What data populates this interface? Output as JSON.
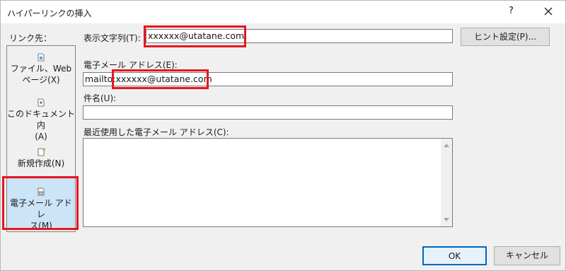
{
  "window": {
    "title": "ハイパーリンクの挿入",
    "help_glyph": "?",
    "close_glyph": "✕"
  },
  "link_to": {
    "label": "リンク先：",
    "items": [
      {
        "line1": "ファイル、Web",
        "line2": "ページ(X)"
      },
      {
        "line1": "このドキュメント内",
        "line2": "(A)"
      },
      {
        "line1": "新規作成(N)",
        "line2": ""
      },
      {
        "line1": "電子メール アドレ",
        "line2": "ス(M)"
      }
    ],
    "selected_index": 3
  },
  "display_text": {
    "label": "表示文字列(T):",
    "value": "xxxxxx@utatane.com"
  },
  "screen_tip_button": "ヒント設定(P)...",
  "email_address": {
    "label": "電子メール アドレス(E):",
    "value": "mailto:xxxxxx@utatane.com"
  },
  "subject": {
    "label": "件名(U):",
    "value": ""
  },
  "recent": {
    "label": "最近使用した電子メール アドレス(C):",
    "items": []
  },
  "ok_button": "OK",
  "cancel_button": "キャンセル",
  "colors": {
    "highlight": "#e8151f",
    "selected_item": "#cce4f7",
    "dialog_bg": "#f0f0f0"
  }
}
